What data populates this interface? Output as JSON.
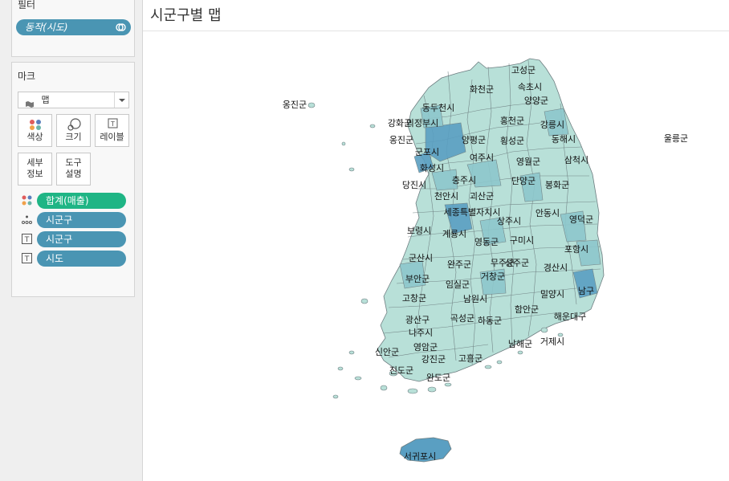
{
  "filters": {
    "title": "필터",
    "items": [
      {
        "label": "동작(시도)"
      }
    ]
  },
  "marks": {
    "title": "마크",
    "mark_type": "맵",
    "buttons": {
      "color": "색상",
      "size": "크기",
      "label": "레이블",
      "detail": "세부\n정보",
      "tooltip": "도구\n설명"
    },
    "fields": [
      {
        "label": "합계(매출)",
        "role": "color",
        "color": "#1fb585"
      },
      {
        "label": "시군구",
        "role": "detail",
        "color": "#4a95b3"
      },
      {
        "label": "시군구",
        "role": "label",
        "color": "#4a95b3"
      },
      {
        "label": "시도",
        "role": "label",
        "color": "#4a95b3"
      }
    ]
  },
  "sheet": {
    "title": "시군구별 맵"
  },
  "map": {
    "colors": {
      "light": "#b8e0d8",
      "mid": "#8dc7cc",
      "dark": "#5a9fc2",
      "border": "#6d7d80"
    },
    "labels": [
      "옹진군",
      "울릉군",
      "고성군",
      "속초시",
      "화천군",
      "양양군",
      "동두천시",
      "강릉시",
      "홍천군",
      "강화군",
      "의정부시",
      "동해시",
      "양평군",
      "횡성군",
      "옹진군",
      "군포시",
      "여주시",
      "삼척시",
      "화성시",
      "영월군",
      "충주시",
      "단양군",
      "당진시",
      "봉화군",
      "천안시",
      "괴산군",
      "세종특별자치시",
      "상주시",
      "안동시",
      "영덕군",
      "보령시",
      "계룡시",
      "영동군",
      "구미시",
      "포항시",
      "군산시",
      "완주군",
      "무주군",
      "성주군",
      "경산시",
      "부안군",
      "거창군",
      "남구",
      "임실군",
      "밀양시",
      "고창군",
      "남원시",
      "함안군",
      "해운대구",
      "광산구",
      "곡성군",
      "하동군",
      "나주시",
      "거제시",
      "남해군",
      "영암군",
      "신안군",
      "강진군",
      "고흥군",
      "진도군",
      "완도군",
      "서귀포시"
    ]
  }
}
